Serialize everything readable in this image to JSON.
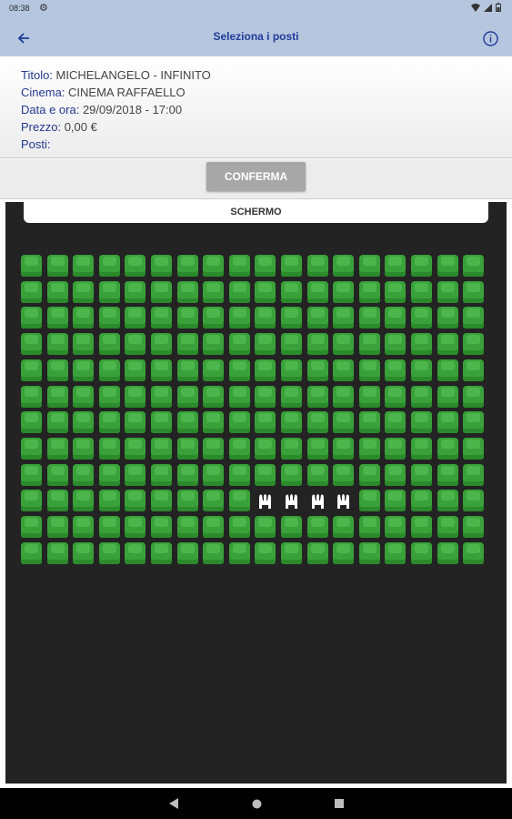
{
  "status_bar": {
    "time": "08:38"
  },
  "app_bar": {
    "title": "Seleziona i posti"
  },
  "details": {
    "title_label": "Titolo:",
    "title_value": "MICHELANGELO - INFINITO",
    "cinema_label": "Cinema:",
    "cinema_value": "CINEMA RAFFAELLO",
    "datetime_label": "Data e ora:",
    "datetime_value": "29/09/2018 - 17:00",
    "price_label": "Prezzo:",
    "price_value": "0,00 €",
    "seats_label": "Posti:",
    "seats_value": ""
  },
  "confirm_button": "CONFERMA",
  "screen_label": "SCHERMO",
  "seat_map": {
    "rows": 12,
    "columns": 18,
    "available_color": "#3aa13a",
    "occupied_color": "#ffffff",
    "occupied": [
      [
        9,
        9
      ],
      [
        9,
        10
      ],
      [
        9,
        11
      ],
      [
        9,
        12
      ]
    ]
  }
}
